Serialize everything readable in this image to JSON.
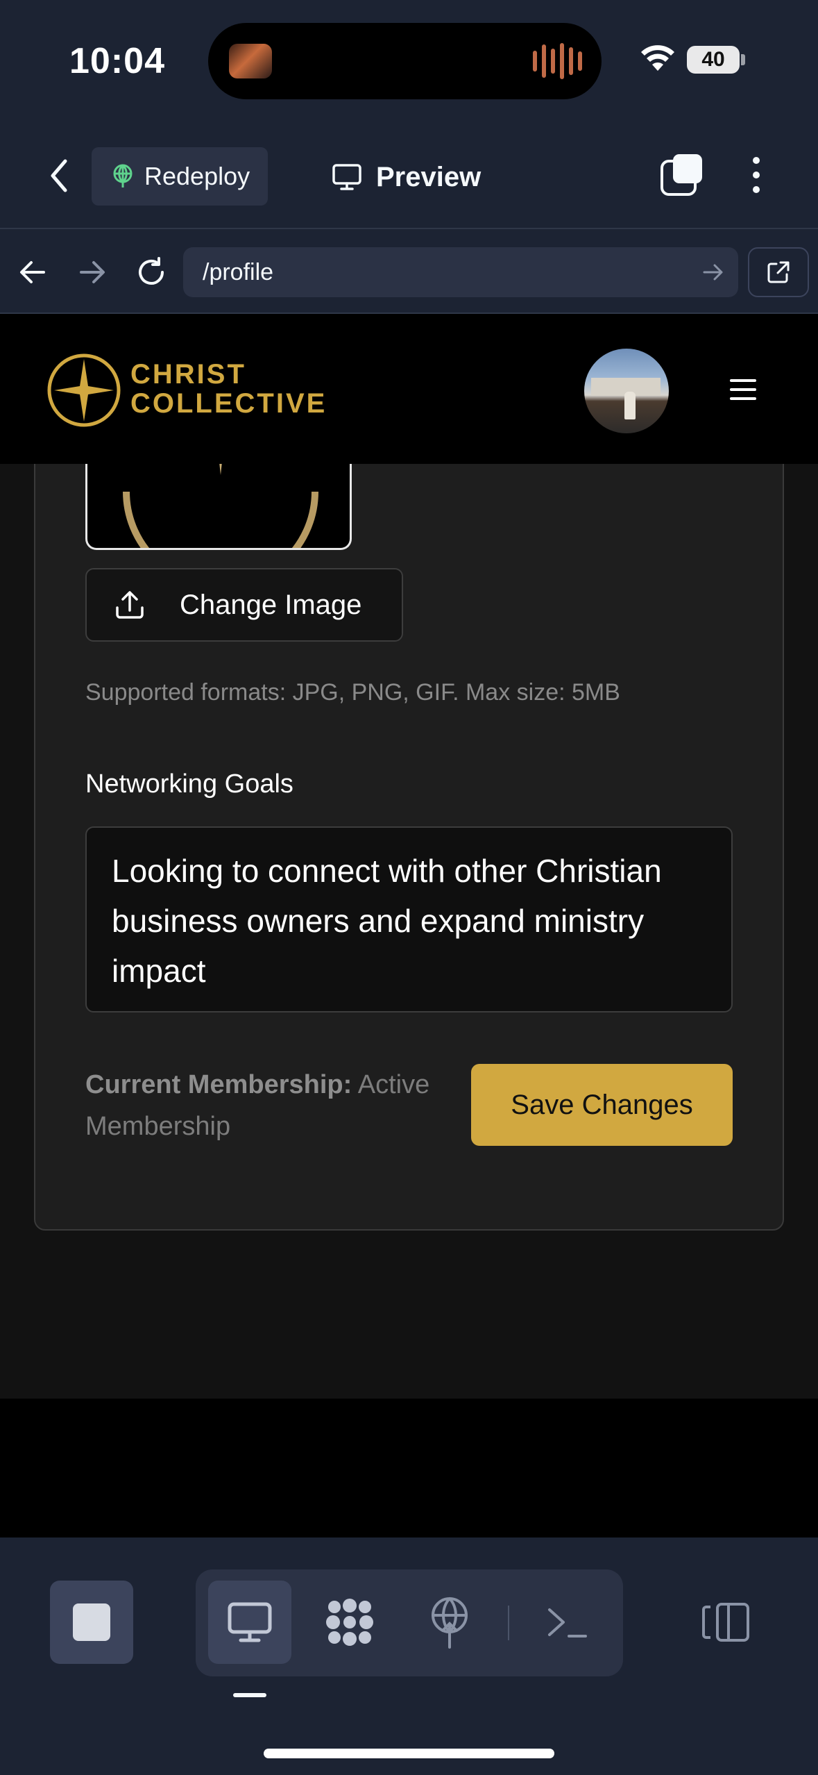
{
  "status_bar": {
    "time": "10:04",
    "battery": "40"
  },
  "toolbar": {
    "redeploy_label": "Redeploy",
    "preview_label": "Preview"
  },
  "browser": {
    "url": "/profile"
  },
  "site": {
    "brand_line1": "CHRIST",
    "brand_line2": "COLLECTIVE",
    "brand_color": "#d1a840"
  },
  "profile_form": {
    "change_image_label": "Change Image",
    "supported_formats": "Supported formats: JPG, PNG, GIF. Max size: 5MB",
    "networking_goals_label": "Networking Goals",
    "networking_goals_value": "Looking to connect with other Christian business owners and expand ministry impact",
    "membership_label": "Current Membership:",
    "membership_value": "Active Membership",
    "save_label": "Save Changes"
  },
  "icons": {
    "status": [
      "wifi-icon",
      "battery-icon"
    ],
    "toolbar": [
      "back-icon",
      "redeploy-icon",
      "monitor-icon",
      "tabs-icon",
      "more-icon"
    ],
    "browser": [
      "arrow-left-icon",
      "arrow-right-icon",
      "reload-icon",
      "go-icon",
      "open-external-icon"
    ],
    "site": [
      "star-logo-icon",
      "hamburger-icon"
    ],
    "form": [
      "upload-icon"
    ],
    "bottom_bar": [
      "stop-icon",
      "monitor-icon",
      "agent-icon",
      "deploy-icon",
      "terminal-icon",
      "panel-toggle-icon"
    ]
  }
}
